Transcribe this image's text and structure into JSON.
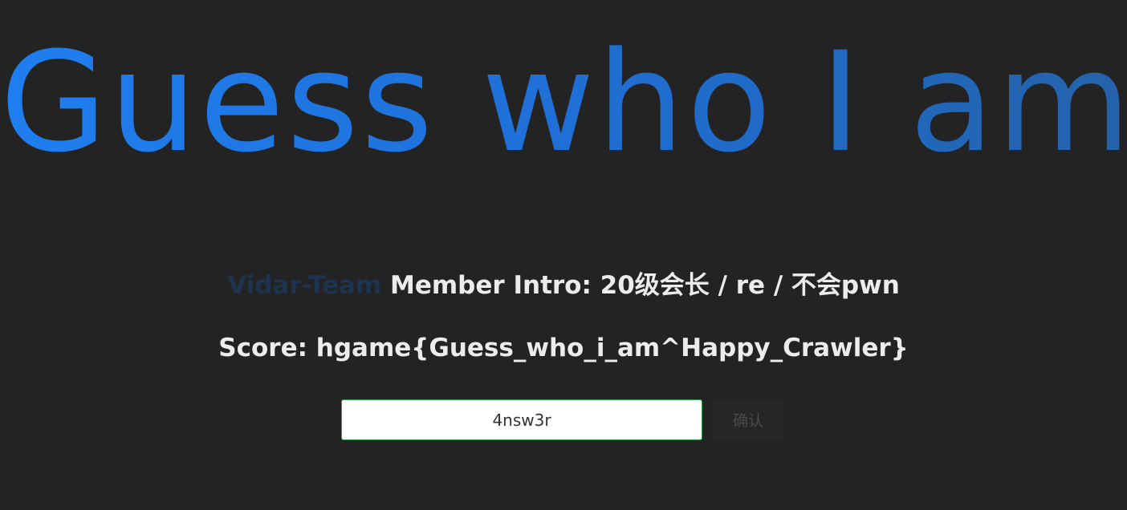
{
  "heading": {
    "title": "Guess who I am"
  },
  "intro": {
    "team": "Vidar-Team",
    "text": "Member Intro: 20级会长 / re / 不会pwn"
  },
  "score": {
    "text": "Score: hgame{Guess_who_i_am^Happy_Crawler}"
  },
  "form": {
    "answer_value": "4nsw3r",
    "confirm_label": "确认"
  },
  "colors": {
    "background": "#232323",
    "title_gradient_start": "#1f7ff0",
    "title_gradient_end": "#2462ab",
    "team_text": "#1c3450",
    "body_text": "#ececec",
    "input_border": "#2b9a4a"
  }
}
